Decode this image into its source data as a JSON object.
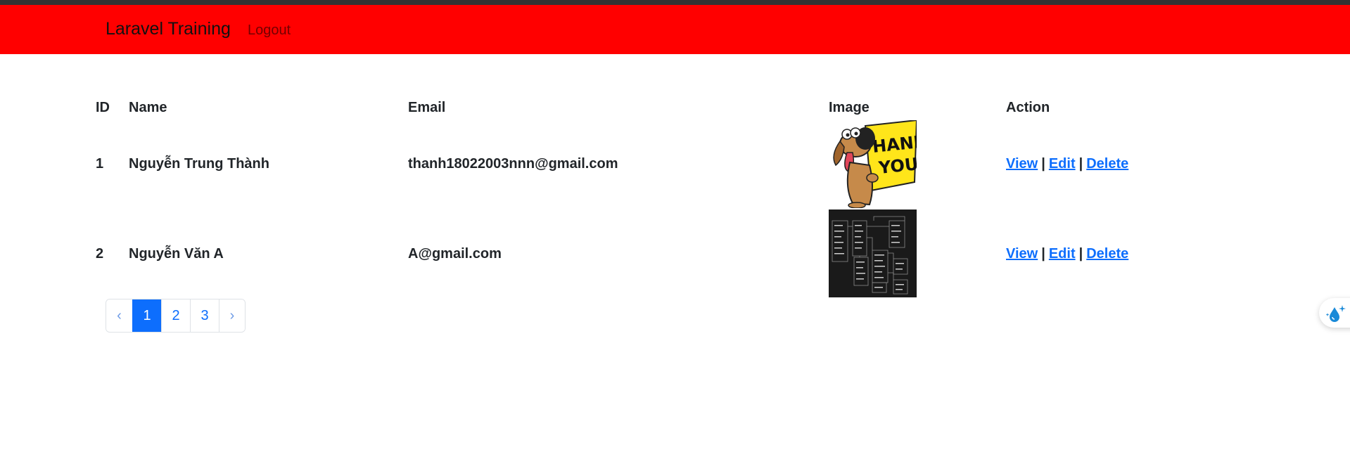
{
  "navbar": {
    "brand": "Laravel Training",
    "logout": "Logout",
    "background_color": "#ff0000"
  },
  "table": {
    "headers": [
      "ID",
      "Name",
      "Email",
      "Image",
      "Action"
    ],
    "rows": [
      {
        "id": "1",
        "name": "Nguyễn Trung Thành",
        "email": "thanh18022003nnn@gmail.com",
        "image_icon": "thank-you-dog-image"
      },
      {
        "id": "2",
        "name": "Nguyễn Văn A",
        "email": "A@gmail.com",
        "image_icon": "diagram-thumbnail-image"
      }
    ],
    "actions": {
      "view": "View",
      "edit": "Edit",
      "delete": "Delete",
      "separator": "|"
    }
  },
  "pagination": {
    "prev": "‹",
    "pages": [
      "1",
      "2",
      "3"
    ],
    "active_page": "1",
    "next": "›",
    "accent_color": "#0d6efd"
  },
  "floating_widget": {
    "icon": "water-drop-sparkle-icon"
  }
}
